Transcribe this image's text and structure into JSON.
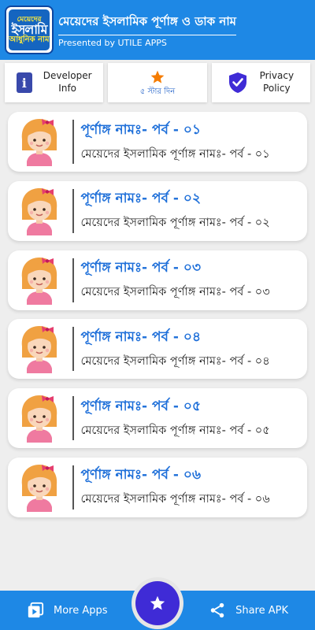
{
  "header": {
    "logo_line1": "মেয়েদের",
    "logo_line2": "ইসলামি",
    "logo_line3": "আধুনিক নাম",
    "title": "মেয়েদের ইসলামিক পূর্ণাঙ্গ ও ডাক নাম",
    "subtitle": "Presented by UTILE APPS"
  },
  "actions": {
    "developer_label_1": "Developer",
    "developer_label_2": "Info",
    "rate_label": "৫ স্টার দিন",
    "privacy_label_1": "Privacy",
    "privacy_label_2": "Policy"
  },
  "colors": {
    "primary": "#1e88e5",
    "title_text": "#1e6fd9",
    "fab": "#3f2bd6",
    "star": "#f57c00"
  },
  "items": [
    {
      "title": "পূর্ণাঙ্গ নামঃ- পর্ব - ০১",
      "subtitle": "মেয়েদের ইসলামিক পূর্ণাঙ্গ নামঃ- পর্ব - ০১"
    },
    {
      "title": "পূর্ণাঙ্গ নামঃ- পর্ব - ০২",
      "subtitle": "মেয়েদের ইসলামিক পূর্ণাঙ্গ নামঃ- পর্ব - ০২"
    },
    {
      "title": "পূর্ণাঙ্গ নামঃ- পর্ব - ০৩",
      "subtitle": "মেয়েদের ইসলামিক পূর্ণাঙ্গ নামঃ- পর্ব - ০৩"
    },
    {
      "title": "পূর্ণাঙ্গ নামঃ- পর্ব - ০৪",
      "subtitle": "মেয়েদের ইসলামিক পূর্ণাঙ্গ নামঃ- পর্ব - ০৪"
    },
    {
      "title": "পূর্ণাঙ্গ নামঃ- পর্ব - ০৫",
      "subtitle": "মেয়েদের ইসলামিক পূর্ণাঙ্গ নামঃ- পর্ব - ০৫"
    },
    {
      "title": "পূর্ণাঙ্গ নামঃ- পর্ব - ০৬",
      "subtitle": "মেয়েদের ইসলামিক পূর্ণাঙ্গ নামঃ- পর্ব - ০৬"
    }
  ],
  "bottom": {
    "more_apps": "More Apps",
    "share_apk": "Share APK"
  }
}
